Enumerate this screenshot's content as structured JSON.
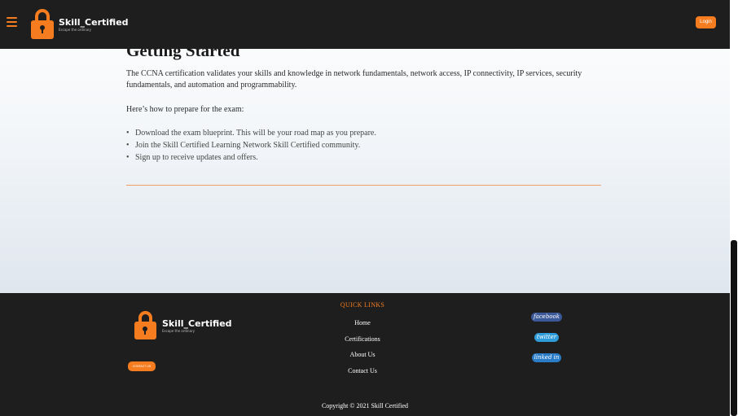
{
  "header": {
    "brand_name": "Skill_Certified",
    "brand_tagline": "Escape the ordinary",
    "login_label": "Login"
  },
  "main": {
    "heading": "Getting Started",
    "intro": "The CCNA certification validates your skills and knowledge in network fundamentals, network access, IP connectivity, IP services, security fundamentals, and automation and programmability.",
    "prep_intro": "Here’s how to prepare for the exam:",
    "steps": [
      "Download the exam blueprint. This will be your road map as you prepare.",
      "Join the Skill Certified Learning Network Skill Certified community.",
      "Sign up to receive updates and offers."
    ]
  },
  "footer": {
    "brand_name": "Skill_Certified",
    "brand_tagline": "Escape the ordinary",
    "contact_label": "CONTACT US",
    "quick_links_title": "QUICK LINKS",
    "quick_links": [
      "Home",
      "Certifications",
      "About Us",
      "Contact Us"
    ],
    "social": [
      "facebook",
      "twitter",
      "linked in"
    ],
    "copyright": "Copyright © 2021 Skill Certified"
  },
  "colors": {
    "accent": "#f57c1f",
    "dark": "#1e1e1e",
    "facebook": "#3b5998",
    "twitter": "#2f9bd8",
    "linkedin": "#2a7cc7"
  },
  "icons": {
    "menu": "hamburger-icon",
    "logo": "padlock-icon"
  }
}
